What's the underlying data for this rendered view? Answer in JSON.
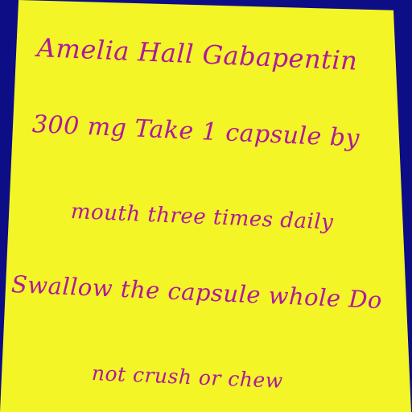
{
  "label": {
    "lines": [
      "Amelia Hall Gabapentin",
      "300 mg Take 1 capsule by",
      "mouth three times daily",
      "Swallow the capsule whole Do",
      "not crush or chew"
    ]
  },
  "colors": {
    "background": "#0d0d85",
    "card": "#f3f527",
    "text": "#b0189a"
  }
}
